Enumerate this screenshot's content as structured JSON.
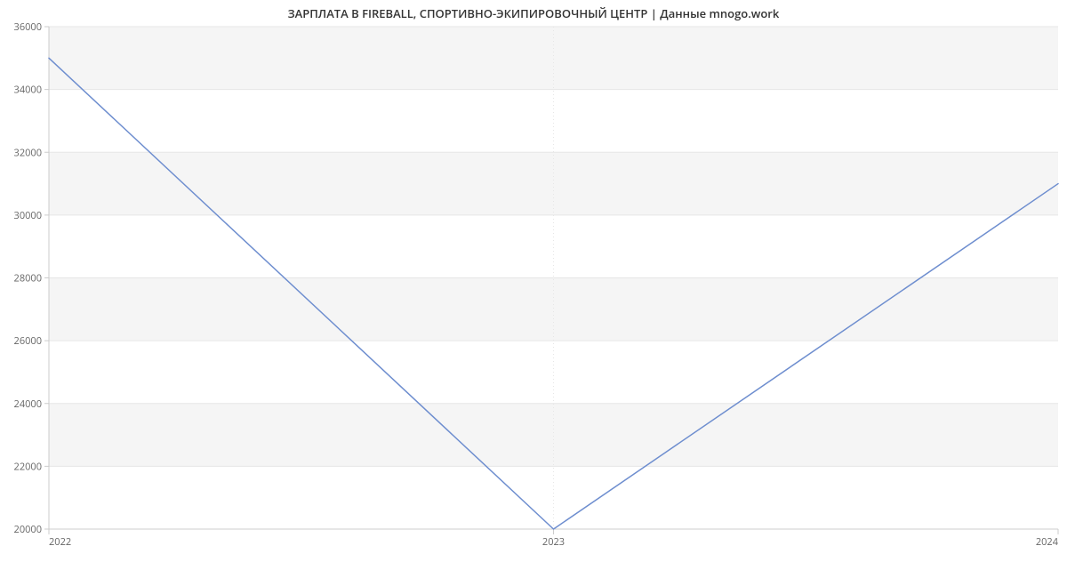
{
  "chart_data": {
    "type": "line",
    "title": "ЗАРПЛАТА В FIREBALL, СПОРТИВНО-ЭКИПИРОВОЧНЫЙ ЦЕНТР | Данные mnogo.work",
    "x": [
      "2022",
      "2023",
      "2024"
    ],
    "values": [
      35000,
      20000,
      31000
    ],
    "xlabel": "",
    "ylabel": "",
    "ylim": [
      20000,
      36000
    ],
    "y_ticks": [
      20000,
      22000,
      24000,
      26000,
      28000,
      30000,
      32000,
      34000,
      36000
    ],
    "x_tick_labels": [
      "2022",
      "2023",
      "2024"
    ],
    "line_color": "#6e8ecf",
    "band_color": "#f5f5f5"
  }
}
